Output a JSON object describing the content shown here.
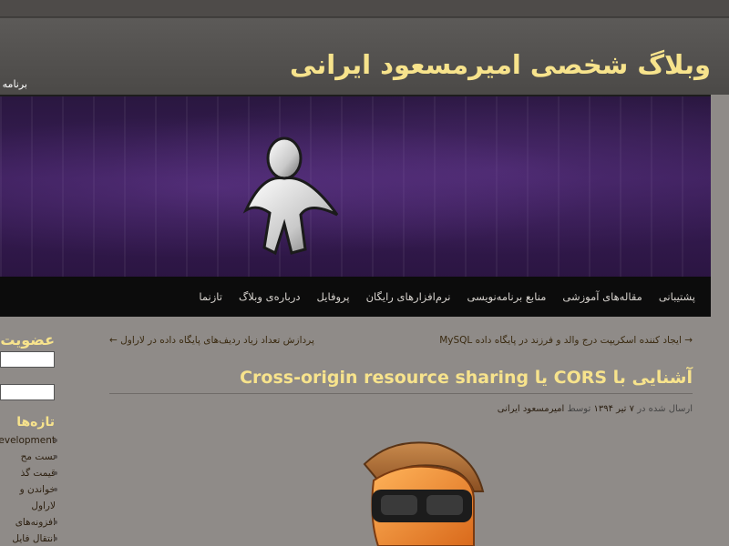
{
  "header": {
    "site_title": "وبلاگ شخصی امیرمسعود ایرانی",
    "desc_fragment": "برنامه"
  },
  "nav": {
    "items": [
      {
        "label": "تازنما"
      },
      {
        "label": "درباره‌ی وبلاگ"
      },
      {
        "label": "پروفایل"
      },
      {
        "label": "نرم‌افزارهای رایگان"
      },
      {
        "label": "منابع برنامه‌نویسی"
      },
      {
        "label": "مقاله‌های آموزشی"
      },
      {
        "label": "پشتیبانی"
      }
    ]
  },
  "post": {
    "prev_link": "→ ایجاد کننده اسکریپت درج والد و فرزند در پایگاه داده MySQL",
    "next_link": "پردازش تعداد زیاد ردیف‌های پایگاه داده در لاراول ←",
    "title": "آشنایی با CORS یا Cross-origin resource sharing",
    "meta_prefix": "ارسال شده در",
    "meta_date": "۷ تیر ۱۳۹۴",
    "meta_by": "توسط",
    "meta_author": "امیرمسعود ایرانی"
  },
  "sidebar": {
    "membership_title": "عضویت",
    "recent_title": "تازه‌ها",
    "recent_items": [
      {
        "text": "Development"
      },
      {
        "text": "تست مح"
      },
      {
        "text": "قیمت گذ"
      },
      {
        "text": "خواندن و"
      },
      {
        "text": "لاراول"
      },
      {
        "text": "افزونه‌های"
      },
      {
        "text": "انتقال فایل"
      }
    ]
  }
}
